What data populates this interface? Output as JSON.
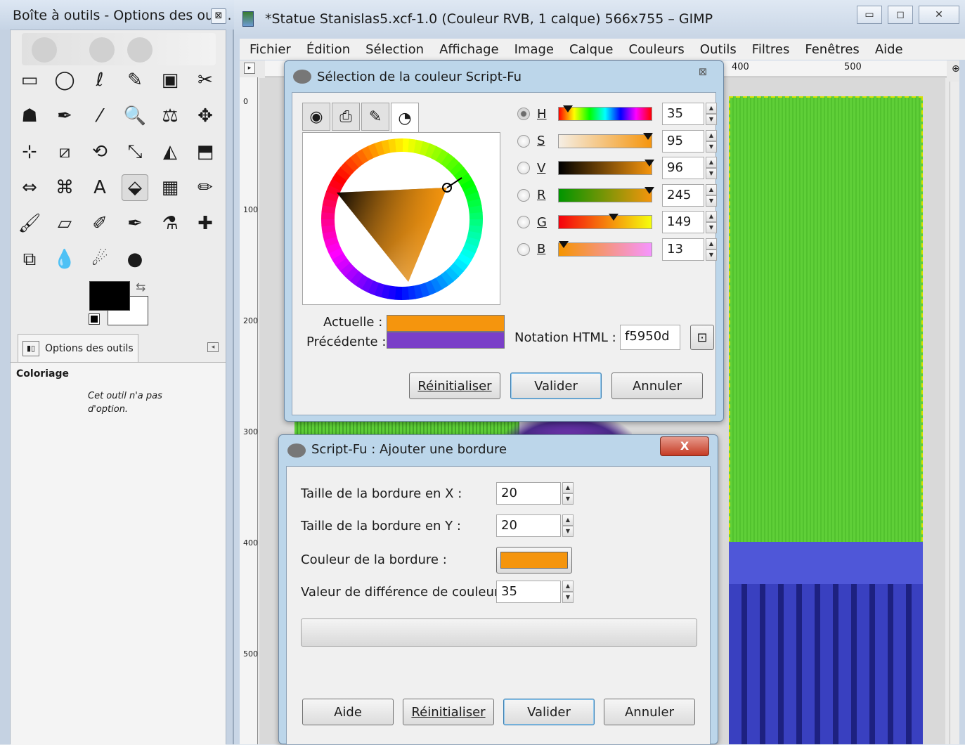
{
  "toolbox": {
    "title": "Boîte à outils - Options des out...",
    "close_glyph": "⊠",
    "tools": [
      "rect-select",
      "ellipse-select",
      "free-select",
      "fuzzy-select",
      "select-by-color",
      "scissors-select",
      "foreground-select",
      "paths",
      "color-picker",
      "zoom",
      "measure",
      "move",
      "align",
      "crop",
      "rotate",
      "scale",
      "shear",
      "perspective",
      "flip",
      "cage-transform",
      "text",
      "bucket-fill",
      "blend",
      "pencil",
      "paintbrush",
      "eraser",
      "airbrush",
      "ink",
      "clone",
      "heal",
      "perspective-clone",
      "blur-sharpen",
      "smudge",
      "dodge-burn"
    ],
    "tool_glyphs": [
      "▭",
      "◯",
      "ℓ",
      "✎",
      "▣",
      "✂",
      "☗",
      "✒",
      "⁄",
      "🔍",
      "⚖",
      "✥",
      "⊹",
      "⧄",
      "⟲",
      "⤡",
      "◭",
      "⬒",
      "⇔",
      "⌘",
      "A",
      "⬙",
      "▦",
      "✏",
      "🖌",
      "▱",
      "✐",
      "✒",
      "⚗",
      "✚",
      "⧉",
      "💧",
      "☄",
      "●"
    ],
    "active_tool_index": 21,
    "tab_label": "Options des outils",
    "tab_icon": "▮▯",
    "options_heading": "Coloriage",
    "options_message": "Cet outil n'a pas d'option.",
    "swap_glyph": "⇆"
  },
  "main": {
    "title": "*Statue Stanislas5.xcf-1.0 (Couleur RVB, 1 calque) 566x755 – GIMP",
    "window_buttons": [
      "▭",
      "◻",
      "✕"
    ],
    "menu": [
      "Fichier",
      "Édition",
      "Sélection",
      "Affichage",
      "Image",
      "Calque",
      "Couleurs",
      "Outils",
      "Filtres",
      "Fenêtres",
      "Aide"
    ],
    "ruler_top_labels": [
      "400",
      "500"
    ],
    "ruler_left_labels": [
      "0",
      "100",
      "200",
      "300",
      "400",
      "500"
    ],
    "nav_glyph": "▸",
    "zoom_glyph": "⊕"
  },
  "color_dialog": {
    "title": "Sélection de la couleur Script-Fu",
    "close_glyph": "⊠",
    "tabs": [
      "gimp",
      "printer",
      "watercolor",
      "wheel"
    ],
    "tab_glyphs": [
      "◉",
      "⎙",
      "✎",
      "◔"
    ],
    "channels": [
      {
        "label": "H",
        "value": "35",
        "selected": true,
        "marker": 0.1
      },
      {
        "label": "S",
        "value": "95",
        "selected": false,
        "marker": 0.95
      },
      {
        "label": "V",
        "value": "96",
        "selected": false,
        "marker": 0.96
      },
      {
        "label": "R",
        "value": "245",
        "selected": false,
        "marker": 0.96
      },
      {
        "label": "G",
        "value": "149",
        "selected": false,
        "marker": 0.58
      },
      {
        "label": "B",
        "value": "13",
        "selected": false,
        "marker": 0.05
      }
    ],
    "current_label": "Actuelle :",
    "previous_label": "Précédente :",
    "current_color": "#f5950d",
    "previous_color": "#7a3fc8",
    "html_label": "Notation HTML :",
    "html_value": "f5950d",
    "picker_glyph": "⊡",
    "buttons": {
      "reset": "Réinitialiser",
      "ok": "Valider",
      "cancel": "Annuler"
    }
  },
  "border_dialog": {
    "title": "Script-Fu : Ajouter une bordure",
    "close_glyph": "X",
    "fields": {
      "x_label": "Taille de la bordure en X :",
      "x_value": "20",
      "y_label": "Taille de la bordure en Y :",
      "y_value": "20",
      "color_label": "Couleur de la bordure :",
      "diff_label": "Valeur de différence de couleur :",
      "diff_value": "35"
    },
    "border_color": "#f5950d",
    "buttons": {
      "help": "Aide",
      "reset": "Réinitialiser",
      "ok": "Valider",
      "cancel": "Annuler"
    }
  }
}
